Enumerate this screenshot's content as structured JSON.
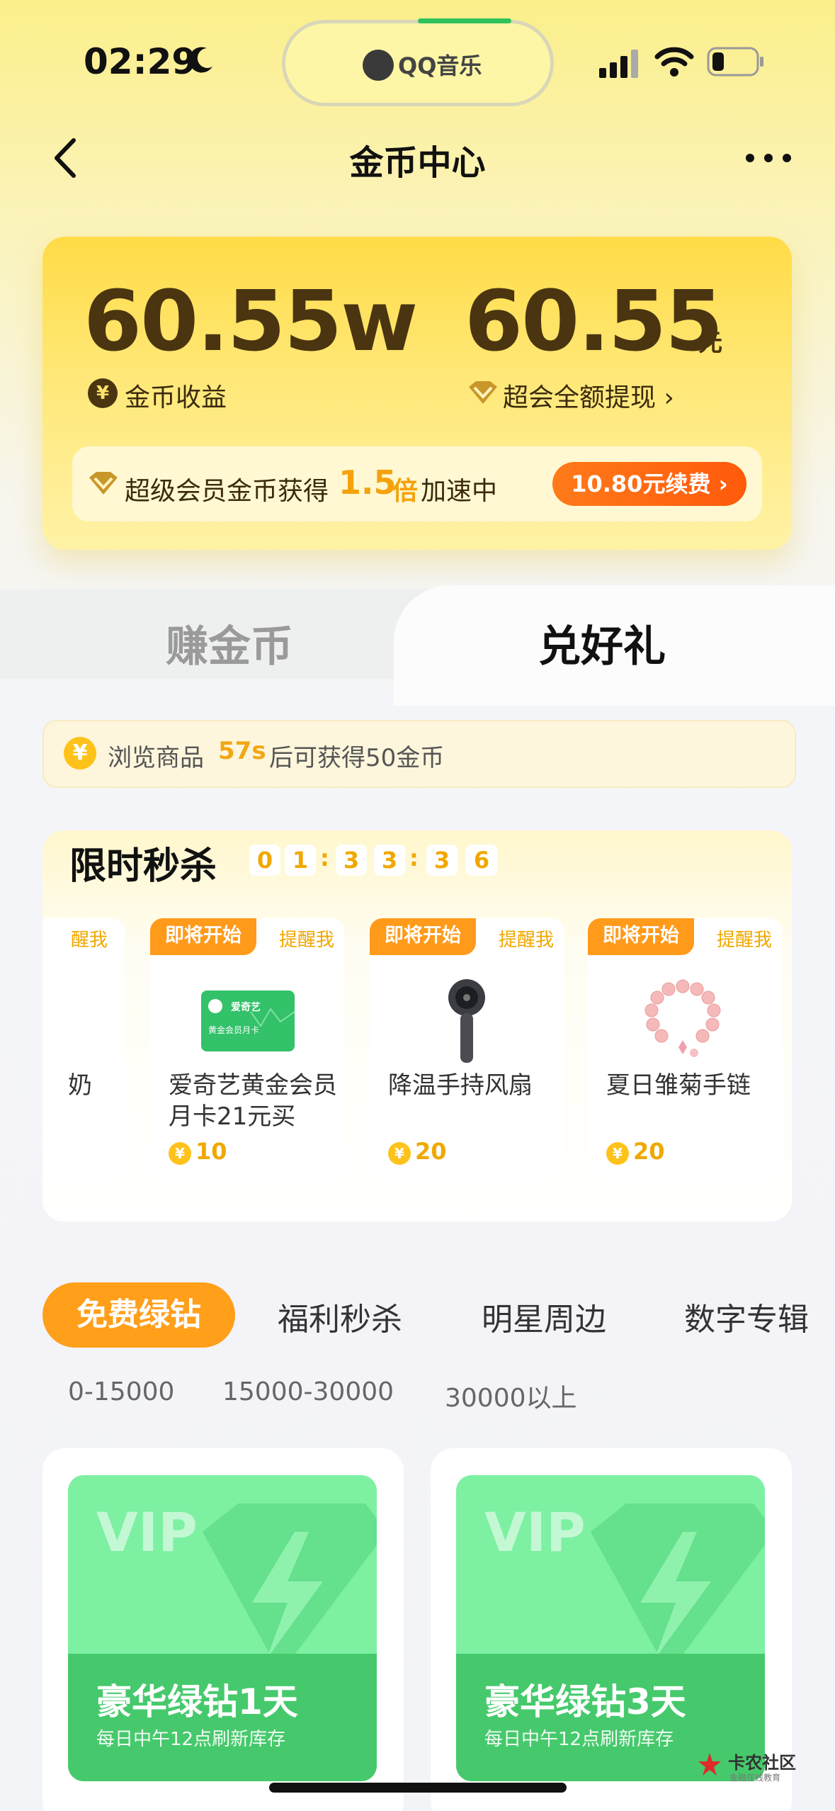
{
  "status": {
    "time": "02:29",
    "island_app": "QQ音乐"
  },
  "header": {
    "title": "金币中心"
  },
  "balance": {
    "coins": "60.55w",
    "coins_label": "金币收益",
    "coin_symbol": "¥",
    "money": "60.55",
    "money_unit": "元",
    "money_label": "超会全额提现 ›",
    "speed_prefix": "超级会员金币获得",
    "speed_mult": "1.5",
    "speed_bei": "倍",
    "speed_suffix": "加速中",
    "renew_label": "10.80元续费 ›"
  },
  "tabs": {
    "earn": "赚金币",
    "redeem": "兑好礼"
  },
  "notice": {
    "icon": "¥",
    "prefix": "浏览商品",
    "seconds": "57s",
    "suffix": "后可获得50金币"
  },
  "flash": {
    "title": "限时秒杀",
    "countdown": [
      "0",
      "1",
      "3",
      "3",
      "3",
      "6"
    ],
    "sep": ":",
    "items": [
      {
        "badge": "",
        "remind": "醒我",
        "name": "奶",
        "price": ""
      },
      {
        "badge": "即将开始",
        "remind": "提醒我",
        "name": "爱奇艺黄金会员月卡21元买",
        "price": "10",
        "icon": "iqiyi-card-icon"
      },
      {
        "badge": "即将开始",
        "remind": "提醒我",
        "name": "降温手持风扇",
        "price": "20",
        "icon": "handheld-fan-icon"
      },
      {
        "badge": "即将开始",
        "remind": "提醒我",
        "name": "夏日雏菊手链",
        "price": "20",
        "icon": "bracelet-icon"
      }
    ],
    "card_logo": "爱奇艺",
    "card_text": "黄金会员月卡"
  },
  "categories": {
    "active": "免费绿钻",
    "others": [
      "福利秒杀",
      "明星周边",
      "数字专辑"
    ]
  },
  "ranges": [
    "0-15000",
    "15000-30000",
    "30000以上"
  ],
  "vip": {
    "badge": "VIP",
    "items": [
      {
        "name": "豪华绿钻1天",
        "sub": "每日中午12点刷新库存"
      },
      {
        "name": "豪华绿钻3天",
        "sub": "每日中午12点刷新库存"
      }
    ]
  },
  "watermark": {
    "title": "卡农社区",
    "sub": "金融在线教育"
  },
  "colors": {
    "accent_orange": "#ff9f1a",
    "gold_text": "#f0a800",
    "dark_brown": "#4a3510",
    "green_vip": "#46c96c"
  }
}
